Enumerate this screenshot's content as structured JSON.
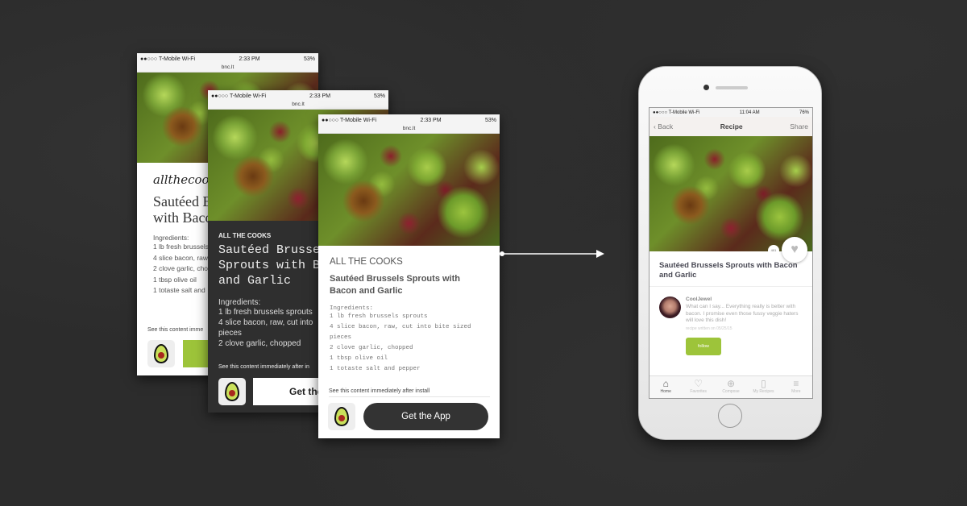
{
  "status": {
    "carrier": "●●○○○ T-Mobile Wi-Fi",
    "time": "2:33 PM",
    "battery": "53%",
    "url": "bnc.lt"
  },
  "screen1": {
    "brand": "allthecook",
    "title": "Sautéed B\nwith Baco",
    "ingredients_label": "Ingredients:",
    "ingredients": [
      "1 lb fresh brussels",
      "4 slice bacon, raw,",
      "2 clove garlic, chop",
      "1 tbsp olive oil",
      "1 totaste salt and"
    ],
    "install_note": "See this content imme",
    "accent": "#9dc43a"
  },
  "screen2": {
    "brand": "ALL THE COOKS",
    "title": "Sautéed Brusse\nSprouts with B\nand Garlic",
    "ingredients_label": "Ingredients:",
    "ingredients": [
      "1 lb fresh brussels sprouts",
      "4 slice bacon, raw, cut into",
      "pieces",
      "2 clove garlic, chopped"
    ],
    "install_note": "See this content immediately after in",
    "cta": "Get the"
  },
  "screen3": {
    "brand": "ALL THE COOKS",
    "title": "Sautéed Brussels Sprouts with Bacon and Garlic",
    "ingredients_label": "Ingredients:",
    "ingredients": [
      "1 lb fresh brussels sprouts",
      "4 slice bacon, raw, cut into bite sized",
      "pieces",
      "2 clove garlic, chopped",
      "1 tbsp olive oil",
      "1 totaste salt and pepper"
    ],
    "install_note": "See this content immediately after install",
    "cta": "Get the App"
  },
  "app": {
    "carrier": "●●○○○ T-Mobile Wi-Fi",
    "time": "11:04 AM",
    "battery": "76%",
    "back": "Back",
    "nav_title": "Recipe",
    "share": "Share",
    "likes": "401",
    "title": "Sautéed Brussels Sprouts with Bacon and Garlic",
    "author": "CoolJewel",
    "comment": "What can I say... Everything really is better with bacon. I promise even those fussy veggie haters will love this dish!",
    "date": "recipe written on 05/25/15",
    "follow": "follow",
    "accent": "#9dc43a",
    "tabs": [
      {
        "label": "Home",
        "icon": "home-icon"
      },
      {
        "label": "Favorites",
        "icon": "heart-icon"
      },
      {
        "label": "Compose",
        "icon": "compose-icon"
      },
      {
        "label": "My Recipes",
        "icon": "book-icon"
      },
      {
        "label": "More",
        "icon": "menu-icon"
      }
    ]
  }
}
